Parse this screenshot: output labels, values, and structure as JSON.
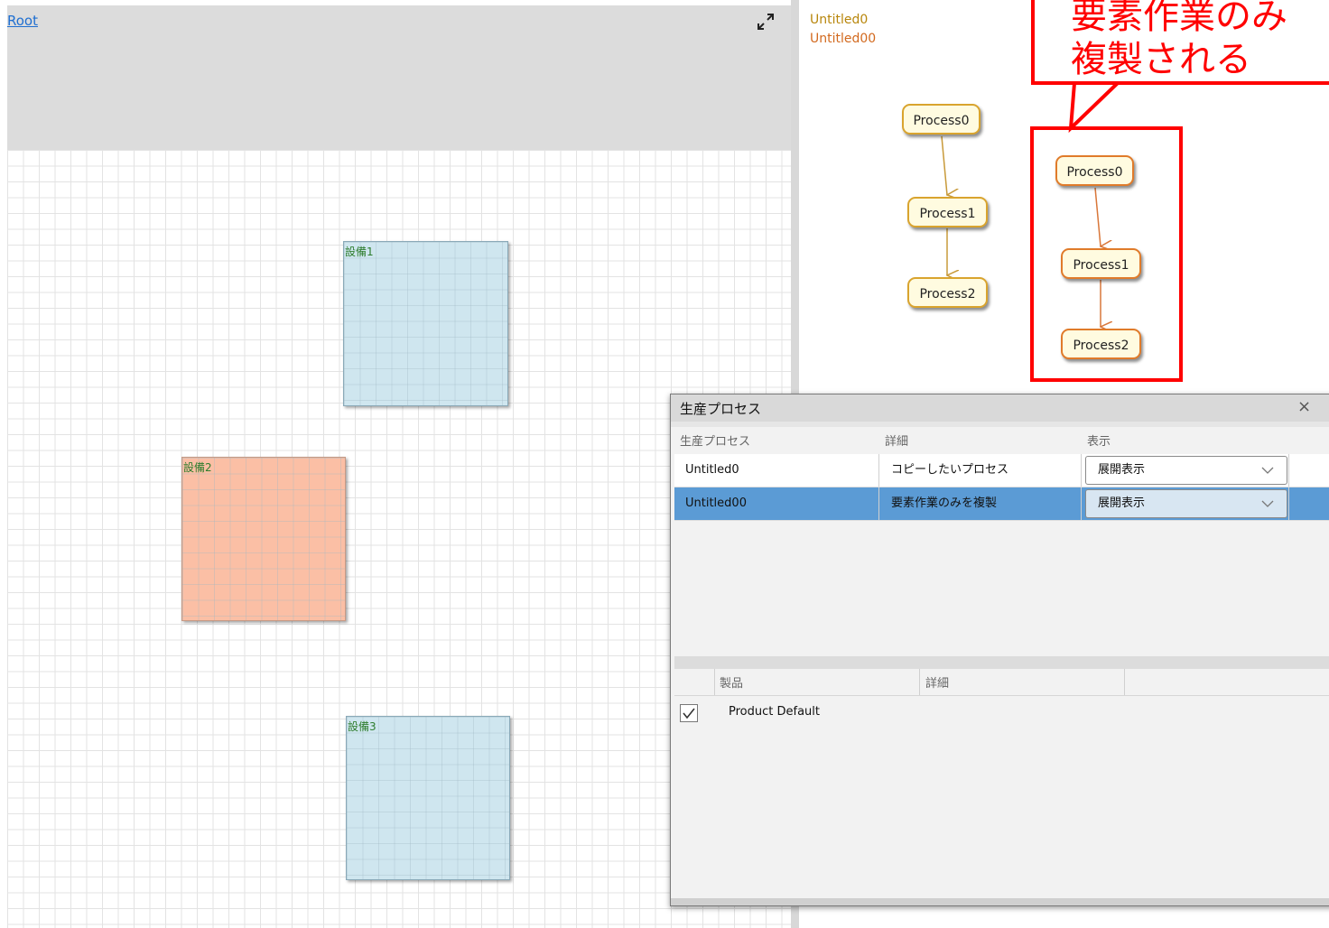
{
  "canvas": {
    "root_link": "Root",
    "equipment": [
      {
        "label": "設備1",
        "color": "#cfe6ef"
      },
      {
        "label": "設備2",
        "color": "#fbbfa5"
      },
      {
        "label": "設備3",
        "color": "#cfe6ef"
      }
    ]
  },
  "diagram": {
    "process_titles": [
      "Untitled0",
      "Untitled00"
    ],
    "original_nodes": [
      "Process0",
      "Process1",
      "Process2"
    ],
    "copied_nodes": [
      "Process0",
      "Process1",
      "Process2"
    ]
  },
  "annotation": {
    "line1": "要素作業のみ",
    "line2": "複製される",
    "color": "#ff0000"
  },
  "dialog": {
    "title": "生産プロセス",
    "close_label": "×",
    "process_table": {
      "headers": [
        "生産プロセス",
        "詳細",
        "表示"
      ],
      "rows": [
        {
          "name": "Untitled0",
          "detail": "コピーしたいプロセス",
          "display": "展開表示",
          "selected": false
        },
        {
          "name": "Untitled00",
          "detail": "要素作業のみを複製",
          "display": "展開表示",
          "selected": true
        }
      ]
    },
    "product_table": {
      "headers": [
        "製品",
        "詳細"
      ],
      "rows": [
        {
          "checked": true,
          "name": "Product Default",
          "detail": ""
        }
      ]
    }
  },
  "colors": {
    "selection": "#5b9bd5",
    "node_border": "#d9a42e",
    "copy_node_border": "#e07b2a"
  }
}
